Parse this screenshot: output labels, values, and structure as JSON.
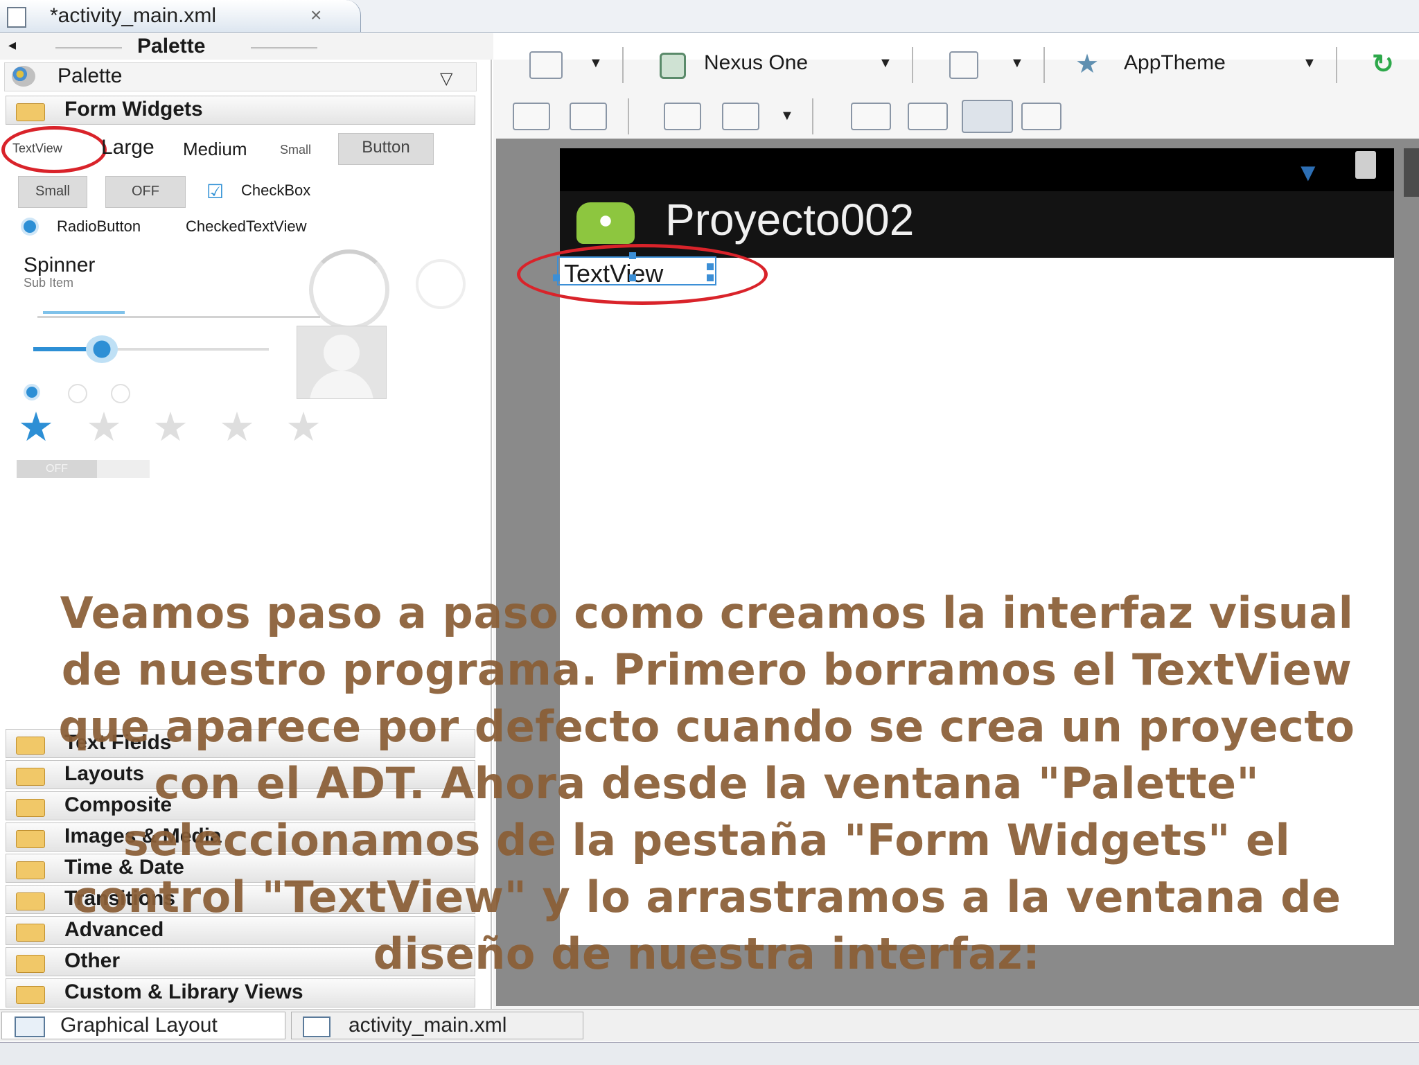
{
  "editor_tab": {
    "title": "*activity_main.xml",
    "close": "×"
  },
  "palette_header": {
    "title": "Palette"
  },
  "palette_bar": {
    "label": "Palette"
  },
  "categories": {
    "form_widgets": "Form Widgets",
    "text_fields": "Text Fields",
    "layouts": "Layouts",
    "composite": "Composite",
    "images_media": "Images & Media",
    "time_date": "Time & Date",
    "transitions": "Transitions",
    "advanced": "Advanced",
    "other": "Other",
    "custom_library": "Custom & Library Views"
  },
  "widgets": {
    "textview": "TextView",
    "large": "Large",
    "medium": "Medium",
    "small_text": "Small",
    "button": "Button",
    "small_button": "Small",
    "toggle_off": "OFF",
    "checkbox": "CheckBox",
    "radiobutton": "RadioButton",
    "checkedtextview": "CheckedTextView",
    "spinner": "Spinner",
    "spinner_sub": "Sub Item",
    "switch_off": "OFF",
    "rating": "1 of 5 stars"
  },
  "toolbar": {
    "device": "Nexus One",
    "theme": "AppTheme"
  },
  "phone": {
    "app_title": "Proyecto002",
    "textview": "TextView"
  },
  "bottom_tabs": {
    "graphical": "Graphical Layout",
    "xml": "activity_main.xml"
  },
  "caption": "Veamos paso a paso como creamos la interfaz visual de nuestro programa. Primero borramos el TextView que aparece por defecto cuando se crea un proyecto con el ADT. Ahora desde la ventana \"Palette\" seleccionamos de la pestaña \"Form Widgets\" el control \"TextView\" y lo arrastramos a la ventana de diseño de nuestra interfaz:",
  "colors": {
    "accent_blue": "#2d8fd5",
    "caption": "#8a5e36",
    "highlight_red": "#d9232a"
  }
}
